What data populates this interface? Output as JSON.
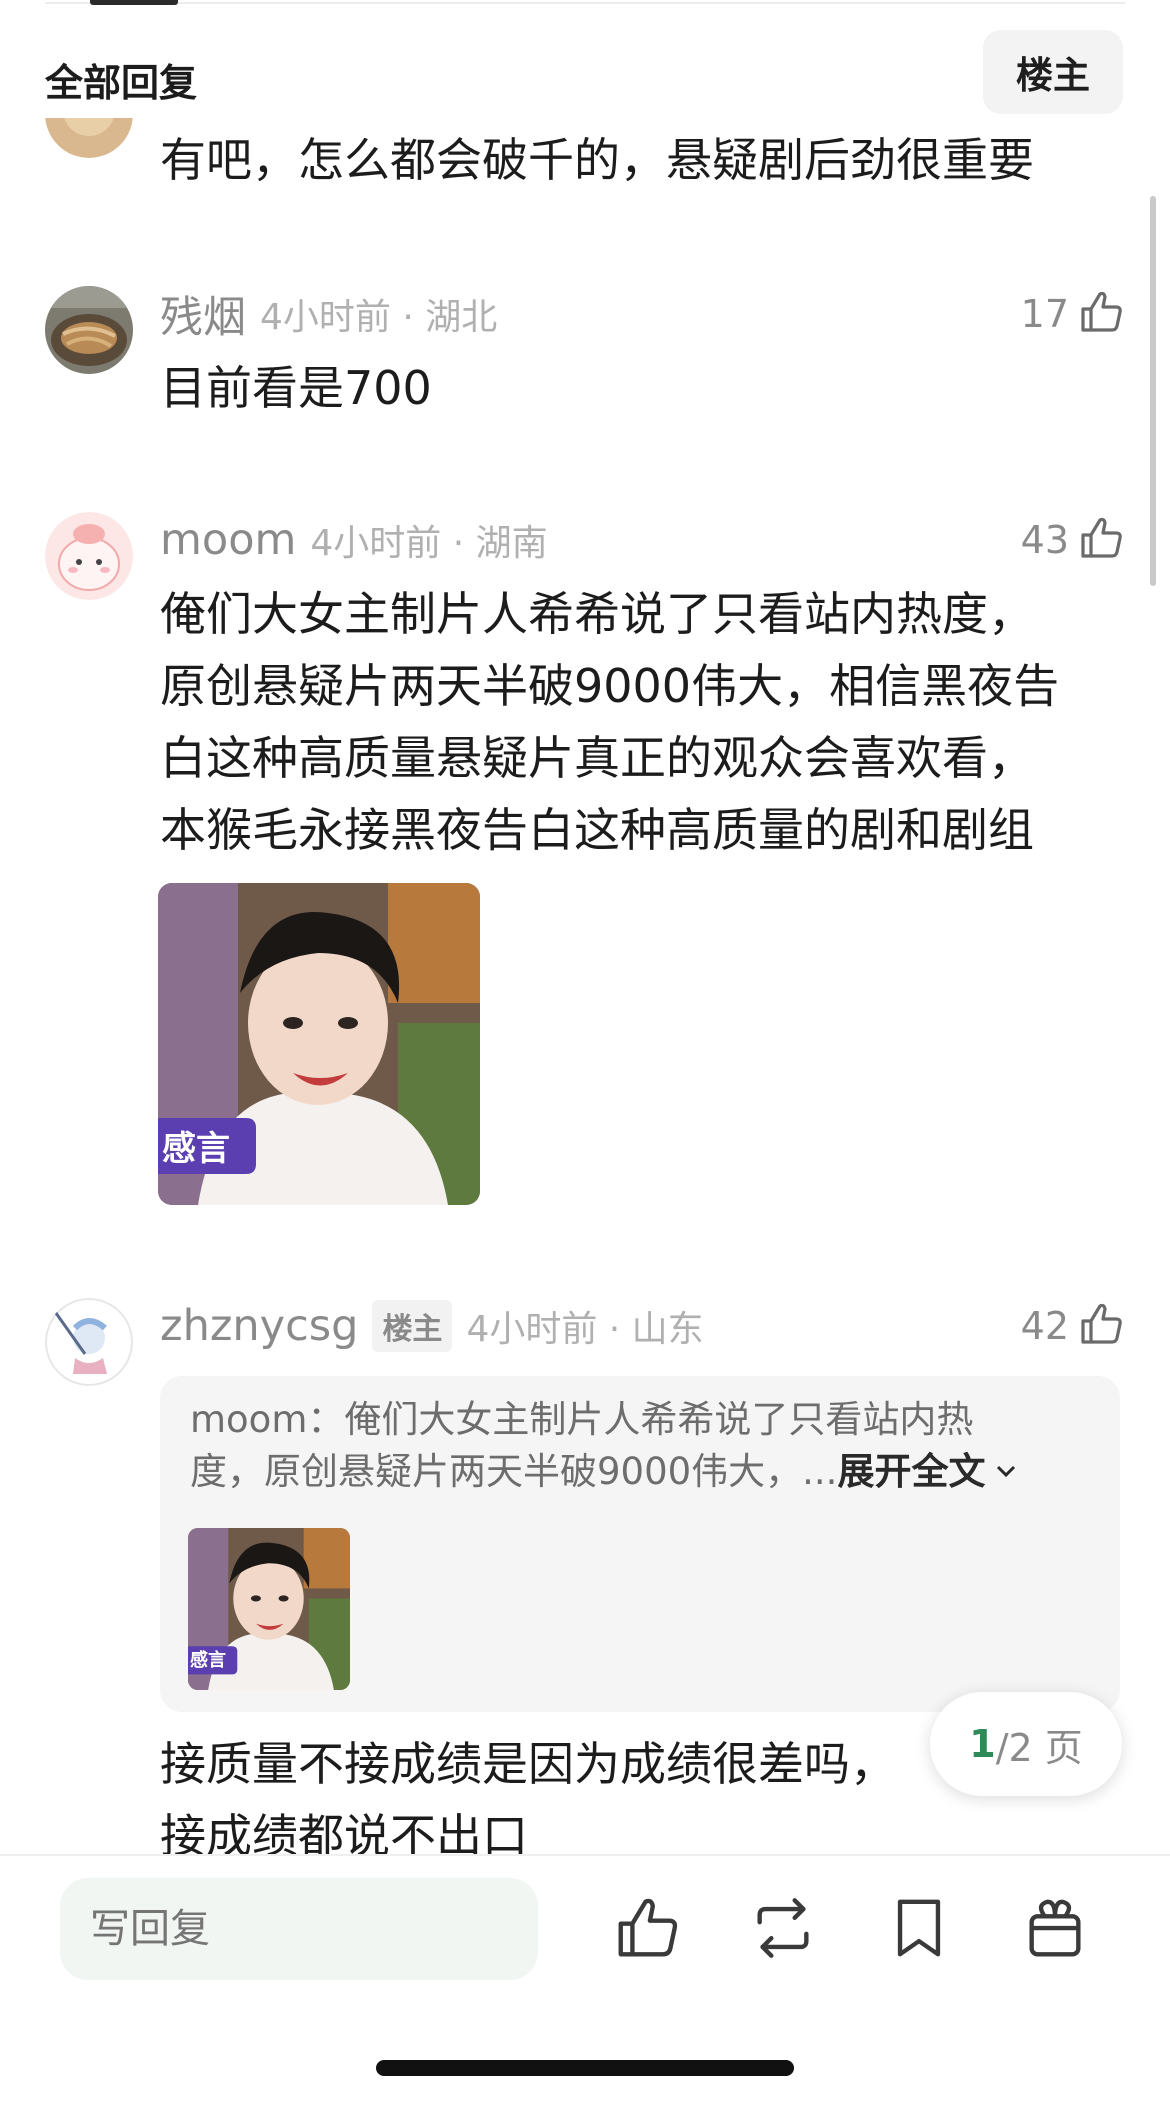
{
  "header": {
    "title": "全部回复",
    "filter_label": "楼主"
  },
  "comments": [
    {
      "text": "有吧，怎么都会破千的，悬疑剧后劲很重要"
    },
    {
      "username": "残烟",
      "time_location": "4小时前 · 湖北",
      "likes": "17",
      "text": "目前看是700"
    },
    {
      "username": "moom",
      "time_location": "4小时前 · 湖南",
      "likes": "43",
      "text_lines": [
        "俺们大女主制片人希希说了只看站内热度，",
        "原创悬疑片两天半破9000伟大，相信黑夜告",
        "白这种高质量悬疑片真正的观众会喜欢看，",
        "本猴毛永接黑夜告白这种高质量的剧和剧组"
      ],
      "sticker_text": "感言"
    },
    {
      "username": "zhznycsg",
      "badge": "楼主",
      "time_location": "4小时前 · 山东",
      "likes": "42",
      "quote_line1": "moom：俺们大女主制片人希希说了只看站内热",
      "quote_line2": "度，原创悬疑片两天半破9000伟大，...",
      "quote_expand": "展开全文",
      "sticker_text": "感言",
      "text_lines": [
        "接质量不接成绩是因为成绩很差吗，",
        "接成绩都说不出口"
      ]
    }
  ],
  "pagination": {
    "current": "1",
    "total_text": "/2 页"
  },
  "bottom_bar": {
    "reply_placeholder": "写回复"
  },
  "icons": [
    "thumbs-up-icon",
    "repost-icon",
    "bookmark-icon",
    "gift-icon",
    "chevron-down-icon"
  ]
}
